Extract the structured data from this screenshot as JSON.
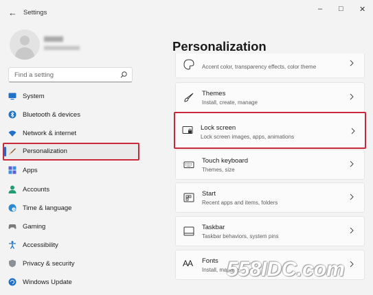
{
  "app": {
    "title": "Settings",
    "back_glyph": "←"
  },
  "window_controls": {
    "minimize": "–",
    "maximize": "□",
    "close": "✕"
  },
  "search": {
    "placeholder": "Find a setting"
  },
  "nav": [
    {
      "label": "System",
      "icon": "monitor-icon"
    },
    {
      "label": "Bluetooth & devices",
      "icon": "bluetooth-icon"
    },
    {
      "label": "Network & internet",
      "icon": "wifi-icon"
    },
    {
      "label": "Personalization",
      "icon": "brush-icon",
      "selected": true
    },
    {
      "label": "Apps",
      "icon": "apps-icon"
    },
    {
      "label": "Accounts",
      "icon": "person-icon"
    },
    {
      "label": "Time & language",
      "icon": "globe-clock-icon"
    },
    {
      "label": "Gaming",
      "icon": "gamepad-icon"
    },
    {
      "label": "Accessibility",
      "icon": "accessibility-icon"
    },
    {
      "label": "Privacy & security",
      "icon": "shield-icon"
    },
    {
      "label": "Windows Update",
      "icon": "update-icon"
    }
  ],
  "main": {
    "title": "Personalization",
    "cards": [
      {
        "title": "",
        "subtitle": "Accent color, transparency effects, color theme",
        "icon": "palette-icon"
      },
      {
        "title": "Themes",
        "subtitle": "Install, create, manage",
        "icon": "themes-brush-icon"
      },
      {
        "title": "Lock screen",
        "subtitle": "Lock screen images, apps, animations",
        "icon": "lock-screen-icon",
        "highlighted": true
      },
      {
        "title": "Touch keyboard",
        "subtitle": "Themes, size",
        "icon": "keyboard-icon"
      },
      {
        "title": "Start",
        "subtitle": "Recent apps and items, folders",
        "icon": "start-icon"
      },
      {
        "title": "Taskbar",
        "subtitle": "Taskbar behaviors, system pins",
        "icon": "taskbar-icon"
      },
      {
        "title": "Fonts",
        "subtitle": "Install, manage",
        "icon": "fonts-icon"
      }
    ],
    "fonts_icon_text": "AA"
  },
  "watermark": "558IDC.com",
  "colors": {
    "accent": "#2a66c4",
    "highlight_border": "#c8283a",
    "background": "#f3f3f3",
    "card": "#fbfbfb"
  }
}
